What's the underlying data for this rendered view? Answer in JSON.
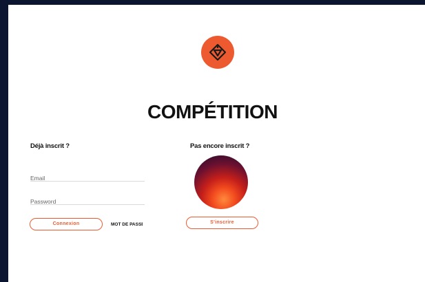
{
  "page": {
    "title": "COMPÉTITION"
  },
  "login": {
    "heading": "Déjà inscrit ?",
    "email_placeholder": "Email",
    "password_placeholder": "Password",
    "login_button": "Connexion",
    "forgot_password": "MOT DE PASSE OUBLIÉ"
  },
  "signup": {
    "heading": "Pas encore inscrit ?",
    "signup_button": "S'inscrire"
  },
  "colors": {
    "accent": "#ee5a30",
    "frame": "#0b1530",
    "panel": "#ffffff"
  },
  "icons": {
    "logo": "brand-diamond-logo"
  }
}
